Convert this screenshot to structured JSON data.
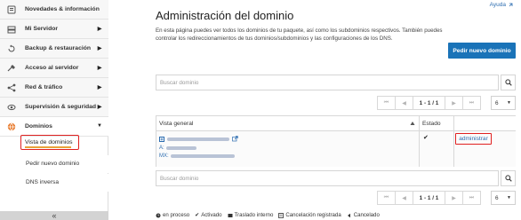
{
  "sidebar": {
    "items": [
      {
        "label": "Novedades & información",
        "icon": "info-icon"
      },
      {
        "label": "Mi Servidor",
        "icon": "server-icon"
      },
      {
        "label": "Backup & restauración",
        "icon": "backup-icon"
      },
      {
        "label": "Acceso al servidor",
        "icon": "key-icon"
      },
      {
        "label": "Red & tráfico",
        "icon": "network-icon"
      },
      {
        "label": "Supervisión & seguridad",
        "icon": "monitor-icon"
      },
      {
        "label": "Dominios",
        "icon": "globe-icon"
      }
    ],
    "subitems": [
      "Vista de dominios",
      "Pedir nuevo dominio",
      "DNS inversa"
    ],
    "collapse_label": "«"
  },
  "main": {
    "help_label": "Ayuda",
    "title": "Administración del dominio",
    "description": "En esta página puedes ver todos los dominios de tu paquete, así como los subdominios respectivos. También puedes controlar los redireccionamientos de tus dominios/subdominios y las configuraciones de los DNS.",
    "order_button": "Pedir nuevo dominio",
    "search_placeholder": "Buscar dominio",
    "pager": {
      "first": "⏮",
      "prev": "◀",
      "range": "1 - 1 / 1",
      "next": "▶",
      "last": "⏭",
      "per_page": "6"
    },
    "table": {
      "headers": [
        "Vista general",
        "Estado",
        ""
      ],
      "row": {
        "a_prefix": "A:",
        "mx_prefix": "MX:",
        "status_mark": "✔",
        "action": "administrar"
      }
    },
    "legend": [
      {
        "icon": "clock-icon",
        "label": "en proceso"
      },
      {
        "icon": "check-icon",
        "label": "Activado"
      },
      {
        "icon": "transfer-icon",
        "label": "Traslado interno"
      },
      {
        "icon": "cancel-registered-icon",
        "label": "Cancelación registrada"
      },
      {
        "icon": "cancelled-icon",
        "label": "Cancelado"
      }
    ]
  },
  "colors": {
    "accent": "#1a73b8",
    "highlight_border": "#e02020",
    "underline": "#e8a33a",
    "link": "#2b6cb0"
  }
}
